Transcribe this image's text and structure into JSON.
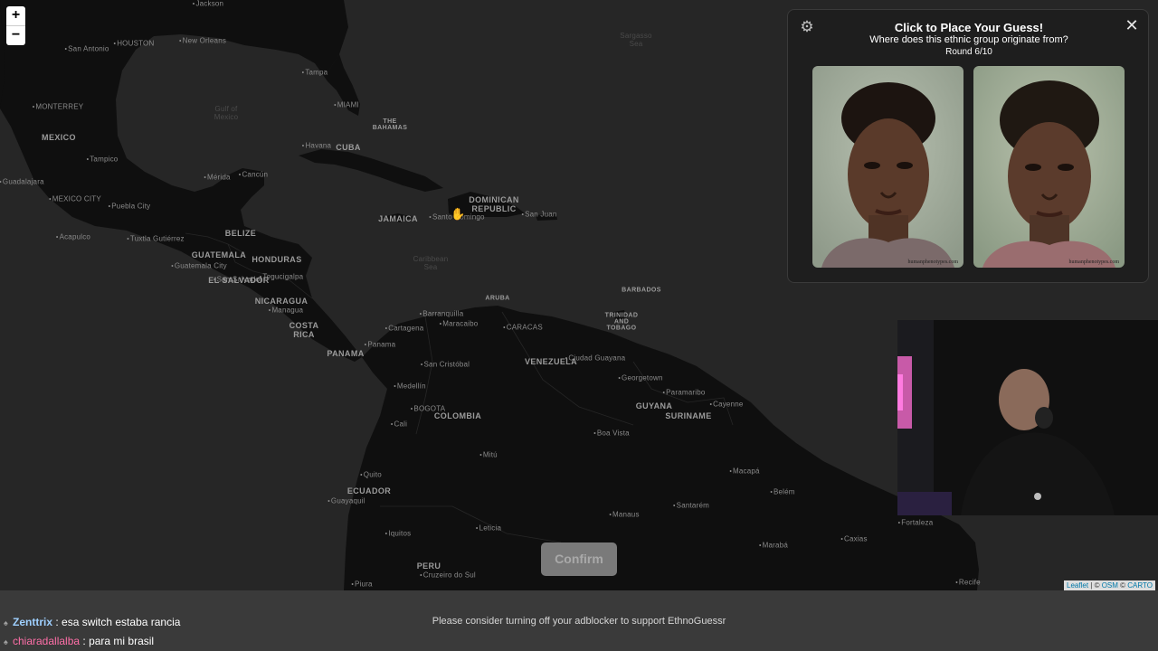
{
  "map": {
    "zoom_in_label": "+",
    "zoom_out_label": "−",
    "labels": {
      "countries": [
        "MEXICO",
        "CUBA",
        "JAMAICA",
        "DOMINICAN REPUBLIC",
        "GUATEMALA",
        "HONDURAS",
        "NICARAGUA",
        "COSTA RICA",
        "PANAMA",
        "EL SALVADOR",
        "BELIZE",
        "VENEZUELA",
        "COLOMBIA",
        "GUYANA",
        "SURINAME",
        "ECUADOR",
        "PERU",
        "TRINIDAD AND TOBAGO",
        "ARUBA",
        "BARBADOS",
        "THE BAHAMAS"
      ],
      "cities": [
        "Jackson",
        "HOUSTON",
        "New Orleans",
        "San Antonio",
        "Tampa",
        "MIAMI",
        "MONTERREY",
        "Tampico",
        "Guadalajara",
        "MEXICO CITY",
        "Puebla City",
        "Acapulco",
        "Tuxtla Gutiérrez",
        "Mérida",
        "Cancún",
        "Havana",
        "Santo Domingo",
        "San Juan",
        "Guatemala City",
        "San Salvador",
        "Tegucigalpa",
        "Managua",
        "Panama",
        "Cartagena",
        "Barranquilla",
        "Maracaibo",
        "CARACAS",
        "San Cristóbal",
        "Medellín",
        "BOGOTA",
        "Cali",
        "Quito",
        "Guayaquil",
        "Ciudad Guayana",
        "Georgetown",
        "Paramaribo",
        "Cayenne",
        "Boa Vista",
        "Manaus",
        "Santarém",
        "Macapá",
        "Belém",
        "Marabá",
        "Fortaleza",
        "Recife",
        "Caxias",
        "Iquitos",
        "Leticia",
        "Mitú",
        "Cruzeiro do Sul",
        "Piura"
      ],
      "seas": [
        "Gulf of Mexico",
        "Caribbean Sea",
        "Sargasso Sea"
      ]
    }
  },
  "panel": {
    "title": "Click to Place Your Guess!",
    "question": "Where does this ethnic group originate from?",
    "round": "Round 6/10",
    "close_label": "✕",
    "gear_label": "⚙",
    "faces": [
      {
        "alt": "male composite face",
        "watermark": "humanphenotypes.com"
      },
      {
        "alt": "female composite face",
        "watermark": "humanphenotypes.com"
      }
    ]
  },
  "confirm_label": "Confirm",
  "attribution": {
    "leaflet": "Leaflet",
    "sep": " | © ",
    "osm": "OSM",
    "sep2": " © ",
    "carto": "CARTO"
  },
  "bottom": {
    "ad_notice": "Please consider turning off your adblocker to support EthnoGuessr",
    "chat": [
      {
        "user": "Zenttrix",
        "sep": " : ",
        "message": "esa switch estaba rancia"
      },
      {
        "user": "chiaradallalba",
        "sep": " : ",
        "message": "para mi brasil"
      }
    ]
  },
  "colors": {
    "map_water": "#262626",
    "map_land": "#0e0e0e",
    "panel_bg": "#1e1e1e",
    "bottom_bar": "#3a3a3a",
    "confirm_disabled": "#7a7a7a",
    "chat_user1": "#9fd0ff",
    "chat_user2": "#ff6fa8"
  },
  "icons": [
    "zoom-in-icon",
    "zoom-out-icon",
    "gear-icon",
    "close-icon",
    "hand-cursor-icon",
    "chat-badge-icon"
  ]
}
